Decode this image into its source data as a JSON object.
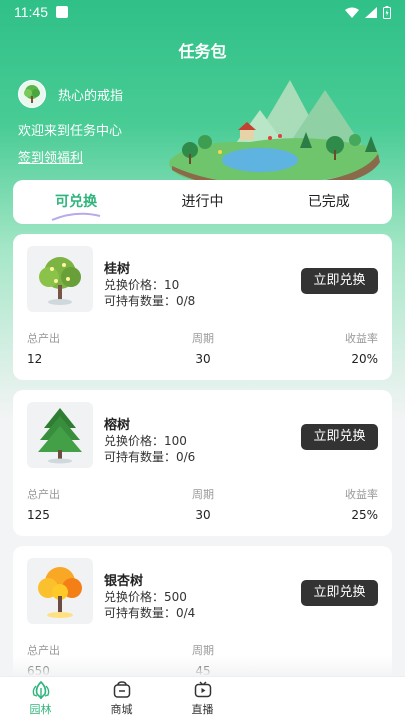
{
  "status": {
    "time": "11:45"
  },
  "header": {
    "title": "任务包"
  },
  "user": {
    "name": "热心的戒指",
    "welcome": "欢迎来到任务中心",
    "signin": "签到领福利"
  },
  "tabs": [
    {
      "label": "可兑换",
      "active": true
    },
    {
      "label": "进行中",
      "active": false
    },
    {
      "label": "已完成",
      "active": false
    }
  ],
  "labels": {
    "button": "立即兑换",
    "price_prefix": "兑换价格：",
    "hold_prefix": "可持有数量：",
    "total": "总产出",
    "period": "周期",
    "yield": "收益率"
  },
  "items": [
    {
      "name": "桂树",
      "price": "兑换价格：10",
      "hold": "可持有数量：0/8",
      "total": "12",
      "period": "30",
      "yield": "20%",
      "icon": "osmanthus-tree-icon"
    },
    {
      "name": "榕树",
      "price": "兑换价格：100",
      "hold": "可持有数量：0/6",
      "total": "125",
      "period": "30",
      "yield": "25%",
      "icon": "banyan-tree-icon"
    },
    {
      "name": "银杏树",
      "price": "兑换价格：500",
      "hold": "可持有数量：0/4",
      "total": "650",
      "period": "45",
      "yield": "",
      "icon": "ginkgo-tree-icon"
    }
  ],
  "nav": [
    {
      "label": "园林",
      "icon": "garden-icon",
      "active": true
    },
    {
      "label": "商城",
      "icon": "shop-icon",
      "active": false
    },
    {
      "label": "直播",
      "icon": "live-icon",
      "active": false
    }
  ],
  "colors": {
    "accent": "#2fb57c",
    "button": "#333333",
    "hero": "#2fc088"
  }
}
